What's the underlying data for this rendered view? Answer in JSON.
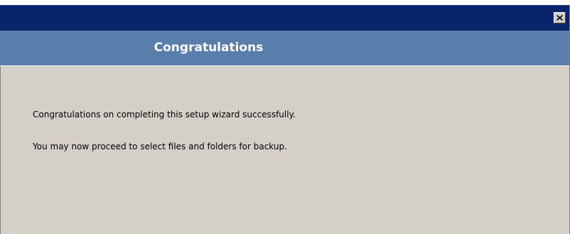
{
  "window": {
    "title": "",
    "close_icon": "close-icon"
  },
  "header": {
    "title": "Congratulations"
  },
  "content": {
    "line1": "Congratulations on completing this setup wizard successfully.",
    "line2": "You may now proceed to select files and folders for backup."
  },
  "colors": {
    "titlebar": "#0a246a",
    "header": "#5a7eac",
    "body": "#d4d0c8"
  }
}
